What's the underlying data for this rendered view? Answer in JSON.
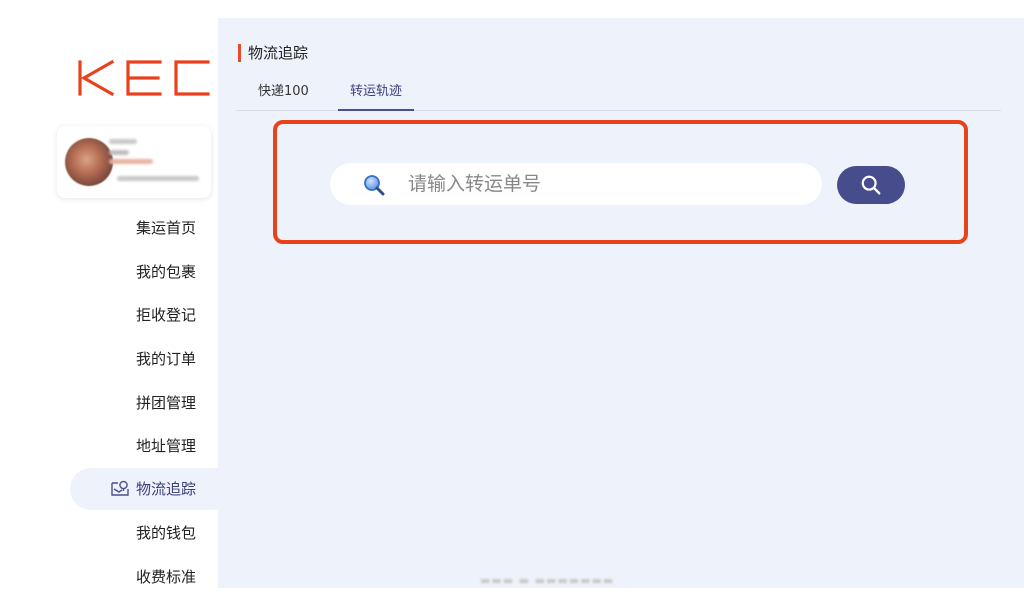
{
  "logo": {
    "text": "KEC",
    "color": "#e8421d"
  },
  "sidebar": {
    "items": [
      {
        "label": "集运首页"
      },
      {
        "label": "我的包裹"
      },
      {
        "label": "拒收登记"
      },
      {
        "label": "我的订单"
      },
      {
        "label": "拼团管理"
      },
      {
        "label": "地址管理"
      },
      {
        "label": "物流追踪",
        "active": true,
        "icon": "map-pin-icon"
      },
      {
        "label": "我的钱包"
      },
      {
        "label": "收费标准"
      }
    ]
  },
  "main": {
    "title": "物流追踪",
    "tabs": [
      {
        "label": "快递100"
      },
      {
        "label": "转运轨迹",
        "active": true
      }
    ],
    "search": {
      "placeholder": "请输入转运单号",
      "icon": "search-icon",
      "button_icon": "search-icon"
    }
  },
  "colors": {
    "accent": "#474c8c",
    "highlight": "#e8421d",
    "content_bg": "#eef3fb"
  }
}
